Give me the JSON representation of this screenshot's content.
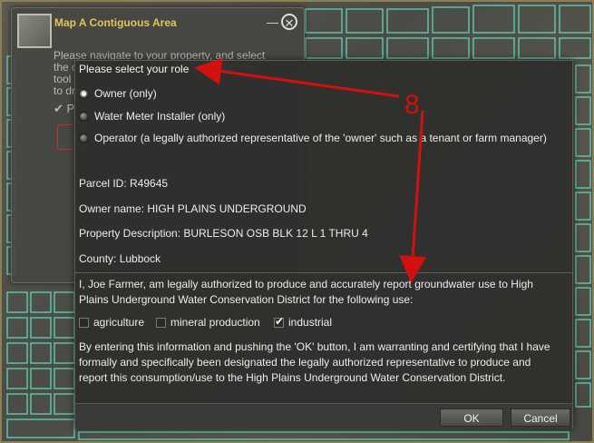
{
  "background_panel": {
    "title": "Map A Contiguous Area",
    "minimize_icon": "minimize-icon",
    "close_icon": "close-icon",
    "instructions_line1": "Please navigate to your property, and select",
    "instructions_line2": "the c",
    "instructions_line2_tail": "Use the tool",
    "instructions_line3": "to dra",
    "checkbox_label": "P"
  },
  "dialog": {
    "role_heading": "Please select your role",
    "roles": [
      {
        "label": "Owner (only)",
        "selected": true
      },
      {
        "label": "Water Meter Installer (only)",
        "selected": false
      },
      {
        "label": "Operator (a legally authorized representative of the 'owner' such as a tenant or farm manager)",
        "selected": false
      }
    ],
    "parcel_id": "Parcel ID: R49645",
    "owner_name": "Owner name: HIGH PLAINS UNDERGROUND",
    "property_description": "Property Description: BURLESON OSB BLK 12 L 1 THRU 4",
    "county": "County: Lubbock",
    "certification": "I, Joe Farmer, am legally authorized to produce and accurately report groundwater use to High Plains Underground Water Conservation District for the following use:",
    "uses": [
      {
        "label": "agriculture",
        "checked": false
      },
      {
        "label": "mineral production",
        "checked": false
      },
      {
        "label": "industrial",
        "checked": true
      }
    ],
    "warranty": "By entering this information and pushing the 'OK' button, I am warranting and certifying that I have formally and specifically been designated the legally authorized representative to produce and report this consumption/use to the High Plains Underground Water Conservation District.",
    "ok_label": "OK",
    "cancel_label": "Cancel"
  },
  "annotation": {
    "number": "8",
    "color": "#d11010"
  },
  "colors": {
    "title_gold": "#e2c45c",
    "parcel_lines": "#63d6c0"
  }
}
